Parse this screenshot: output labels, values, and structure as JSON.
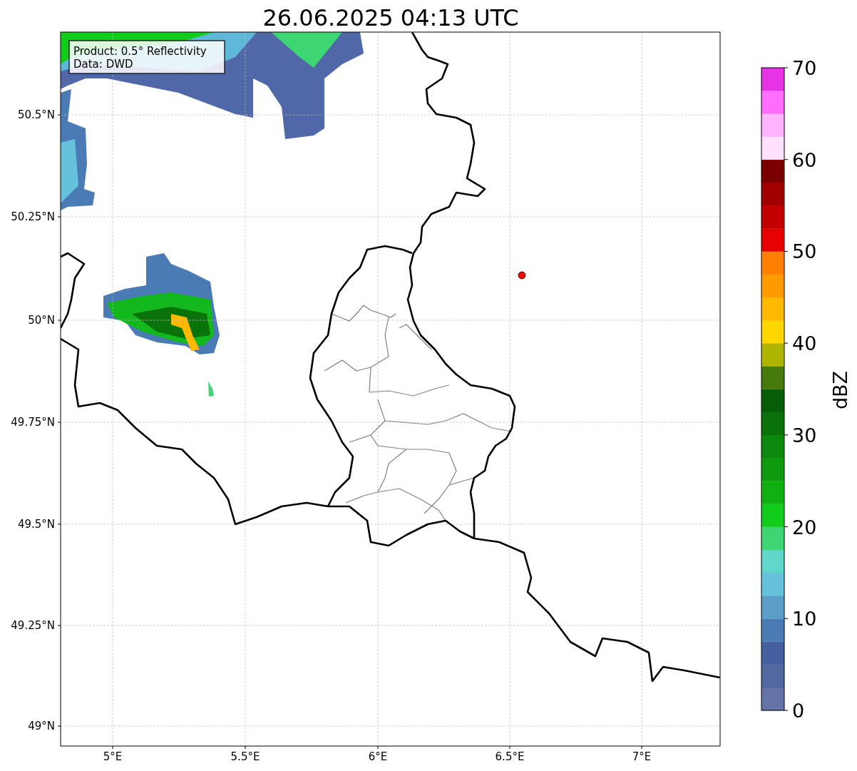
{
  "title": "26.06.2025 04:13 UTC",
  "info_box": [
    "Product: 0.5° Reflectivity",
    "Data: DWD"
  ],
  "map": {
    "lat_ticks": [
      "50.5°N",
      "50.25°N",
      "50°N",
      "49.75°N",
      "49.5°N",
      "49.25°N",
      "49°N"
    ],
    "lon_ticks": [
      "5°E",
      "5.5°E",
      "6°E",
      "6.5°E",
      "7°E"
    ]
  },
  "colorbar": {
    "label": "dBZ",
    "ticks": [
      "70",
      "60",
      "50",
      "40",
      "30",
      "20",
      "10",
      "0"
    ],
    "segments": [
      {
        "color": "#6474a8"
      },
      {
        "color": "#52699f"
      },
      {
        "color": "#4460a0"
      },
      {
        "color": "#4a7bb5"
      },
      {
        "color": "#5a9ec8"
      },
      {
        "color": "#66c2dc"
      },
      {
        "color": "#5fd6c8"
      },
      {
        "color": "#3ed672"
      },
      {
        "color": "#12cc1c"
      },
      {
        "color": "#10b010"
      },
      {
        "color": "#0e9a0e"
      },
      {
        "color": "#0c880c"
      },
      {
        "color": "#0a720a"
      },
      {
        "color": "#075e07"
      },
      {
        "color": "#467a0c"
      },
      {
        "color": "#aeb400"
      },
      {
        "color": "#ffd700"
      },
      {
        "color": "#ffb900"
      },
      {
        "color": "#ff9a00"
      },
      {
        "color": "#ff7f00"
      },
      {
        "color": "#e60000"
      },
      {
        "color": "#c20000"
      },
      {
        "color": "#a00000"
      },
      {
        "color": "#7a0000"
      },
      {
        "color": "#ffe0ff"
      },
      {
        "color": "#ffb3ff"
      },
      {
        "color": "#ff6eff"
      },
      {
        "color": "#e633e6"
      }
    ]
  }
}
